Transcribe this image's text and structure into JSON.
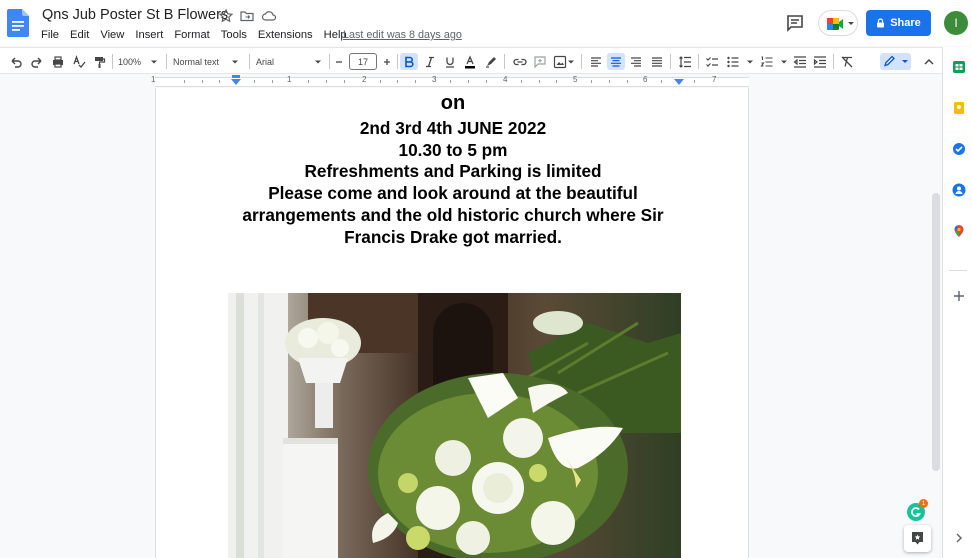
{
  "window": {
    "doc_title": "Qns Jub Poster St B Flowers",
    "last_edit": "Last edit was 8 days ago",
    "share_label": "Share",
    "avatar_initial": "I"
  },
  "menu": [
    "File",
    "Edit",
    "View",
    "Insert",
    "Format",
    "Tools",
    "Extensions",
    "Help"
  ],
  "toolbar": {
    "zoom": "100%",
    "style": "Normal text",
    "font": "Arial",
    "font_size": "17",
    "active": [
      "bold",
      "align-center"
    ]
  },
  "ruler": {
    "numbers": [
      "1",
      "1",
      "2",
      "3",
      "4",
      "5",
      "6",
      "7"
    ]
  },
  "document": {
    "lines": [
      "on",
      "2nd 3rd 4th   JUNE 2022",
      "10.30 to 5 pm",
      "Refreshments and Parking is limited",
      "Please come and look around at the beautiful",
      "arrangements and the old historic church where Sir",
      "Francis Drake got married."
    ]
  },
  "colors": {
    "share_blue": "#1a73e8",
    "avatar_green": "#3c8c3a",
    "active_button": "#d3e3fd"
  },
  "icons": {
    "side_panel": [
      "sheets-icon",
      "keep-icon",
      "tasks-icon",
      "contacts-icon",
      "maps-icon",
      "add-icon",
      "expand-icon"
    ],
    "grammarly_badge": "1"
  }
}
